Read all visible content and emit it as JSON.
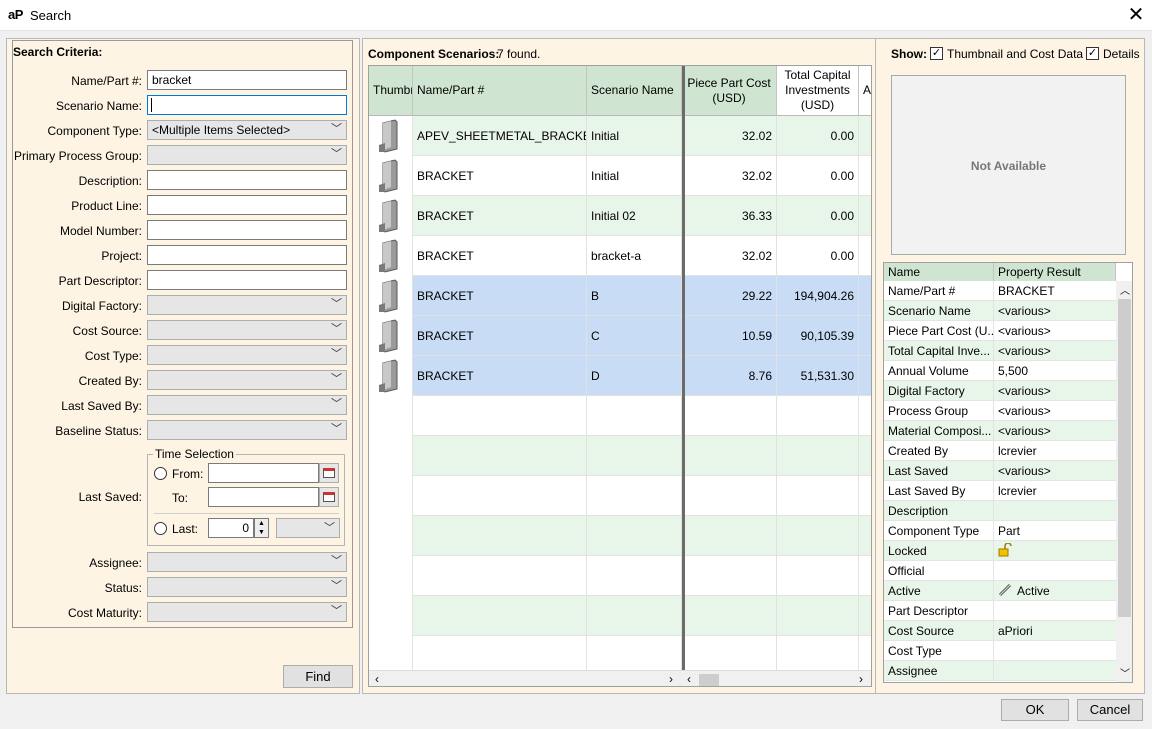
{
  "window": {
    "logo": "aP",
    "title": "Search",
    "close_glyph": "✕"
  },
  "criteria": {
    "title": "Search Criteria:",
    "fields": [
      {
        "label": "Name/Part #:",
        "kind": "text",
        "value": "bracket"
      },
      {
        "label": "Scenario Name:",
        "kind": "text",
        "value": ""
      },
      {
        "label": "Component Type:",
        "kind": "combo",
        "value": "<Multiple Items Selected>"
      },
      {
        "label": "Primary Process Group:",
        "kind": "combo",
        "value": ""
      },
      {
        "label": "Description:",
        "kind": "text",
        "value": ""
      },
      {
        "label": "Product Line:",
        "kind": "text",
        "value": ""
      },
      {
        "label": "Model Number:",
        "kind": "text",
        "value": ""
      },
      {
        "label": "Project:",
        "kind": "text",
        "value": ""
      },
      {
        "label": "Part Descriptor:",
        "kind": "text",
        "value": ""
      },
      {
        "label": "Digital Factory:",
        "kind": "combo",
        "value": ""
      },
      {
        "label": "Cost Source:",
        "kind": "combo",
        "value": ""
      },
      {
        "label": "Cost Type:",
        "kind": "combo",
        "value": ""
      },
      {
        "label": "Created By:",
        "kind": "combo",
        "value": ""
      },
      {
        "label": "Last Saved By:",
        "kind": "combo",
        "value": ""
      },
      {
        "label": "Baseline Status:",
        "kind": "combo",
        "value": ""
      }
    ],
    "last_saved_label": "Last Saved:",
    "time_selection": {
      "title": "Time Selection",
      "from": "From:",
      "to": "To:",
      "last": "Last:",
      "last_value": "0"
    },
    "after_fields": [
      {
        "label": "Assignee:",
        "kind": "combo",
        "value": ""
      },
      {
        "label": "Status:",
        "kind": "combo",
        "value": ""
      },
      {
        "label": "Cost Maturity:",
        "kind": "combo",
        "value": ""
      }
    ],
    "find_label": "Find"
  },
  "results": {
    "label": "Component Scenarios:",
    "count": "7 found.",
    "columns": [
      "Thumbnail",
      "Name/Part #",
      "Scenario Name",
      "Piece Part Cost (USD)",
      "Total Capital Investments (USD)",
      "A"
    ],
    "rows": [
      {
        "name": "APEV_SHEETMETAL_BRACKET",
        "scenario": "Initial",
        "cost": "32.02",
        "capital": "0.00",
        "selected": false
      },
      {
        "name": "BRACKET",
        "scenario": "Initial",
        "cost": "32.02",
        "capital": "0.00",
        "selected": false
      },
      {
        "name": "BRACKET",
        "scenario": "Initial 02",
        "cost": "36.33",
        "capital": "0.00",
        "selected": false
      },
      {
        "name": "BRACKET",
        "scenario": "bracket-a",
        "cost": "32.02",
        "capital": "0.00",
        "selected": false
      },
      {
        "name": "BRACKET",
        "scenario": "B",
        "cost": "29.22",
        "capital": "194,904.26",
        "selected": true
      },
      {
        "name": "BRACKET",
        "scenario": "C",
        "cost": "10.59",
        "capital": "90,105.39",
        "selected": true
      },
      {
        "name": "BRACKET",
        "scenario": "D",
        "cost": "8.76",
        "capital": "51,531.30",
        "selected": true
      }
    ]
  },
  "show": {
    "label": "Show:",
    "thumbnail_label": "Thumbnail and Cost Data",
    "details_label": "Details",
    "thumbnail_checked": true,
    "details_checked": true
  },
  "preview": {
    "text": "Not Available"
  },
  "properties": {
    "columns": [
      "Name",
      "Property Result"
    ],
    "rows": [
      {
        "name": "Name/Part #",
        "value": "BRACKET"
      },
      {
        "name": "Scenario Name",
        "value": "<various>"
      },
      {
        "name": "Piece Part Cost (U...",
        "value": "<various>"
      },
      {
        "name": "Total Capital Inve...",
        "value": "<various>"
      },
      {
        "name": "Annual Volume",
        "value": "5,500"
      },
      {
        "name": "Digital Factory",
        "value": "<various>"
      },
      {
        "name": "Process Group",
        "value": "<various>"
      },
      {
        "name": "Material Composi...",
        "value": "<various>"
      },
      {
        "name": "Created By",
        "value": "lcrevier"
      },
      {
        "name": "Last Saved",
        "value": "<various>"
      },
      {
        "name": "Last Saved By",
        "value": "lcrevier"
      },
      {
        "name": "Description",
        "value": ""
      },
      {
        "name": "Component Type",
        "value": "Part"
      },
      {
        "name": "Locked",
        "value": "",
        "icon": "unlock-icon"
      },
      {
        "name": "Official",
        "value": ""
      },
      {
        "name": "Active",
        "value": "Active",
        "icon": "link-icon"
      },
      {
        "name": "Part Descriptor",
        "value": ""
      },
      {
        "name": "Cost Source",
        "value": "aPriori"
      },
      {
        "name": "Cost Type",
        "value": ""
      },
      {
        "name": "Assignee",
        "value": ""
      }
    ]
  },
  "footer": {
    "ok_label": "OK",
    "cancel_label": "Cancel"
  },
  "colors": {
    "header_green": "#cfe5d1",
    "row_green": "#e8f5e9",
    "selected_blue": "#c8dcf5",
    "pane_bg": "#fdf4e4"
  }
}
